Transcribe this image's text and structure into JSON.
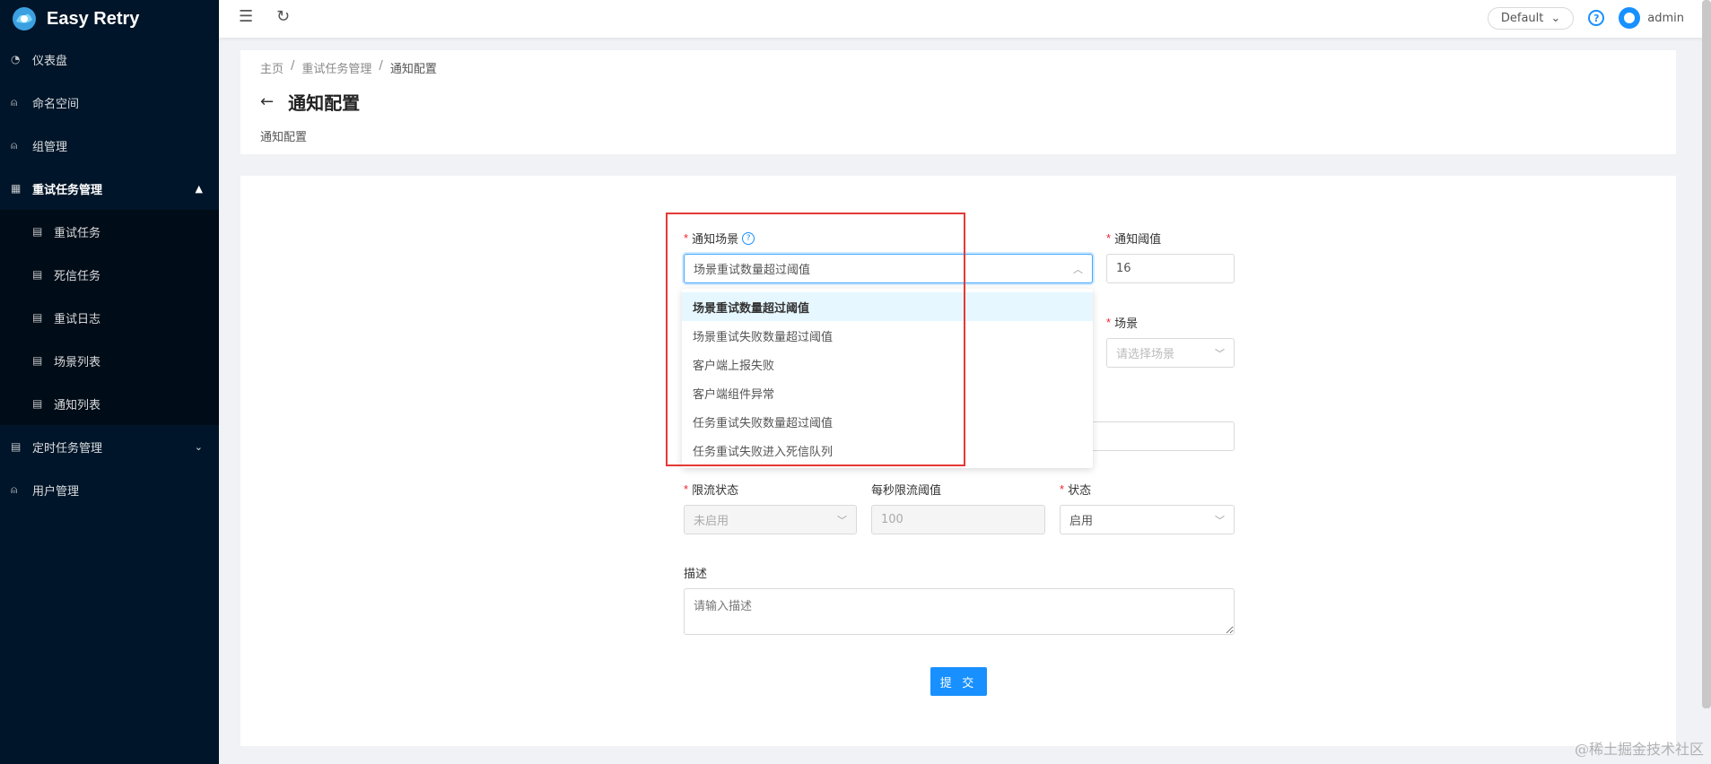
{
  "app": {
    "name": "Easy Retry"
  },
  "sidebar": {
    "items": [
      {
        "label": "仪表盘",
        "icon": "dashboard-icon"
      },
      {
        "label": "命名空间",
        "icon": "user-icon"
      },
      {
        "label": "组管理",
        "icon": "user-icon"
      },
      {
        "label": "重试任务管理",
        "icon": "calendar-icon",
        "open": true,
        "children": [
          {
            "label": "重试任务"
          },
          {
            "label": "死信任务"
          },
          {
            "label": "重试日志"
          },
          {
            "label": "场景列表"
          },
          {
            "label": "通知列表"
          }
        ]
      },
      {
        "label": "定时任务管理",
        "icon": "table-icon"
      },
      {
        "label": "用户管理",
        "icon": "user-icon"
      }
    ]
  },
  "header": {
    "env": "Default",
    "user": "admin"
  },
  "page": {
    "breadcrumb": [
      "主页",
      "重试任务管理",
      "通知配置"
    ],
    "title": "通知配置",
    "subtitle": "通知配置"
  },
  "form": {
    "notify_scene": {
      "label": "通知场景",
      "value": "场景重试数量超过阈值"
    },
    "notify_threshold": {
      "label": "通知阈值",
      "value": "16"
    },
    "scene": {
      "label": "场景",
      "placeholder": "请选择场景"
    },
    "rate_limit_status": {
      "label": "限流状态",
      "value": "未启用"
    },
    "rate_limit_threshold": {
      "label": "每秒限流阈值",
      "value": "100"
    },
    "status": {
      "label": "状态",
      "value": "启用"
    },
    "description": {
      "label": "描述",
      "placeholder": "请输入描述"
    },
    "submit_label": "提 交"
  },
  "dropdown": {
    "options": [
      "场景重试数量超过阈值",
      "场景重试失败数量超过阈值",
      "客户端上报失败",
      "客户端组件异常",
      "任务重试失败数量超过阈值",
      "任务重试失败进入死信队列"
    ],
    "selected_index": 0
  },
  "watermark": "@稀土掘金技术社区",
  "colors": {
    "sidebar_bg": "#001529",
    "primary": "#1890ff",
    "highlight": "#e53935"
  }
}
